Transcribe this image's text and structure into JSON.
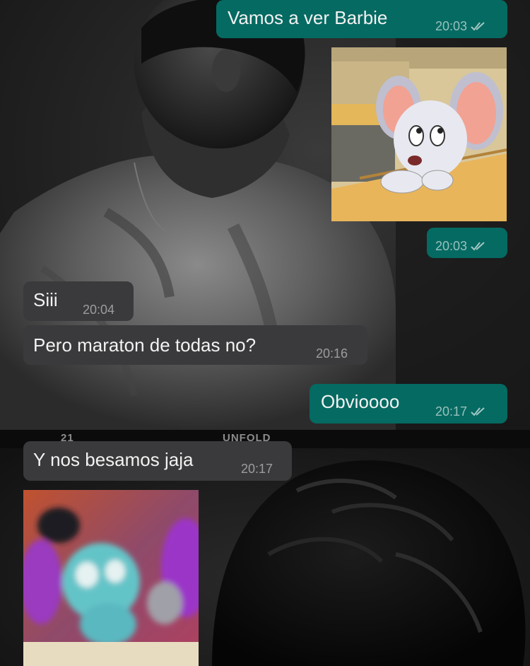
{
  "wallpaper": {
    "strip_left": "21",
    "strip_center": "UNFOLD"
  },
  "messages": [
    {
      "id": "m1",
      "direction": "outgoing",
      "type": "text",
      "text": "Vamos a ver Barbie",
      "time": "20:03",
      "status": "read-double-check"
    },
    {
      "id": "m2",
      "direction": "outgoing",
      "type": "sticker",
      "media_icon": "cartoon-mouse-sticker"
    },
    {
      "id": "m3",
      "direction": "outgoing",
      "type": "timestamp",
      "time": "20:03",
      "status": "read-double-check"
    },
    {
      "id": "m4",
      "direction": "incoming",
      "type": "text",
      "text": "Siii",
      "time": "20:04"
    },
    {
      "id": "m5",
      "direction": "incoming",
      "type": "text",
      "text": "Pero maraton de todas no?",
      "time": "20:16"
    },
    {
      "id": "m6",
      "direction": "outgoing",
      "type": "text",
      "text": "Obvioooo",
      "time": "20:17",
      "status": "read-double-check"
    },
    {
      "id": "m7",
      "direction": "incoming",
      "type": "text",
      "text": "Y nos besamos jaja",
      "time": "20:17"
    },
    {
      "id": "m8",
      "direction": "incoming",
      "type": "gif",
      "media_icon": "blurry-cartoon-rat-gif"
    }
  ],
  "colors": {
    "outgoing_bubble": "#056a62",
    "incoming_bubble": "#3a3a3c",
    "text": "#f2f2f2"
  }
}
